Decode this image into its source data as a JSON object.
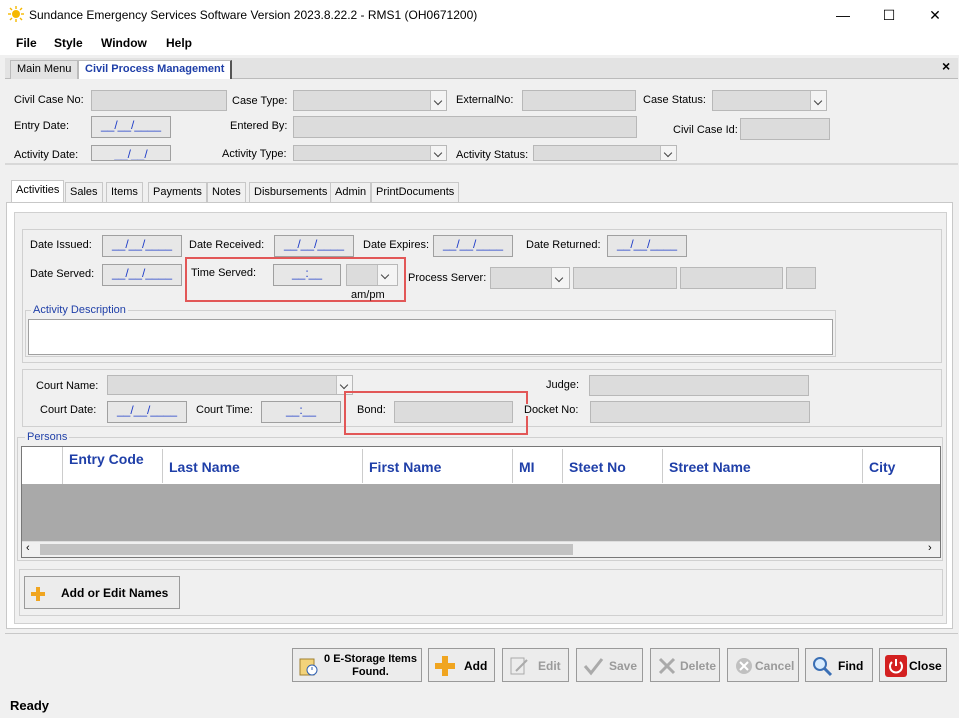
{
  "window": {
    "title": "Sundance Emergency Services Software Version 2023.8.22.2 - RMS1 (OH0671200)",
    "minimize": "—",
    "maximize": "☐",
    "close": "✕"
  },
  "menu": [
    "File",
    "Style",
    "Window",
    "Help"
  ],
  "top_tabs": [
    "Main Menu",
    "Civil Process Management"
  ],
  "tab_close": "×",
  "case": {
    "civil_case_no": "Civil Case No:",
    "case_type": "Case Type:",
    "external_no": "ExternalNo:",
    "case_status": "Case Status:",
    "entry_date": "Entry Date:",
    "entry_date_value": "__/__/____",
    "entered_by": "Entered By:",
    "civil_case_id": "Civil Case Id:",
    "activity_date": "Activity Date:",
    "activity_date_value": "__/__/",
    "activity_type": "Activity Type:",
    "activity_status": "Activity Status:"
  },
  "sub_tabs": [
    "Activities",
    "Sales",
    "Items",
    "Payments",
    "Notes",
    "Disbursements",
    "Admin",
    "PrintDocuments"
  ],
  "activity": {
    "date_issued": "Date Issued:",
    "date_received": "Date Received:",
    "date_expires": "Date Expires:",
    "date_returned": "Date Returned:",
    "date_served": "Date Served:",
    "time_served": "Time Served:",
    "date_placeholder": "__/__/____",
    "time_placeholder": "__:__",
    "ampm": "am/pm",
    "process_server": "Process Server:",
    "description_legend": "Activity Description"
  },
  "court": {
    "court_name": "Court Name:",
    "judge": "Judge:",
    "court_date": "Court Date:",
    "court_date_value": "__/__/____",
    "court_time": "Court Time:",
    "court_time_value": "__:__",
    "bond": "Bond:",
    "docket_no": "Docket No:"
  },
  "persons": {
    "legend": "Persons",
    "columns": [
      "Entry Code",
      "Last Name",
      "First Name",
      "MI",
      "Steet No",
      "Street Name",
      "City"
    ],
    "add_edit": "Add or Edit Names"
  },
  "buttons": {
    "estorage": "0 E-Storage Items Found.",
    "add": "Add",
    "edit": "Edit",
    "save": "Save",
    "delete": "Delete",
    "cancel": "Cancel",
    "find": "Find",
    "close": "Close"
  },
  "status": "Ready",
  "colors": {
    "accent_blue": "#1f3fa8",
    "highlight_red": "#e25757",
    "close_red": "#d32020"
  }
}
